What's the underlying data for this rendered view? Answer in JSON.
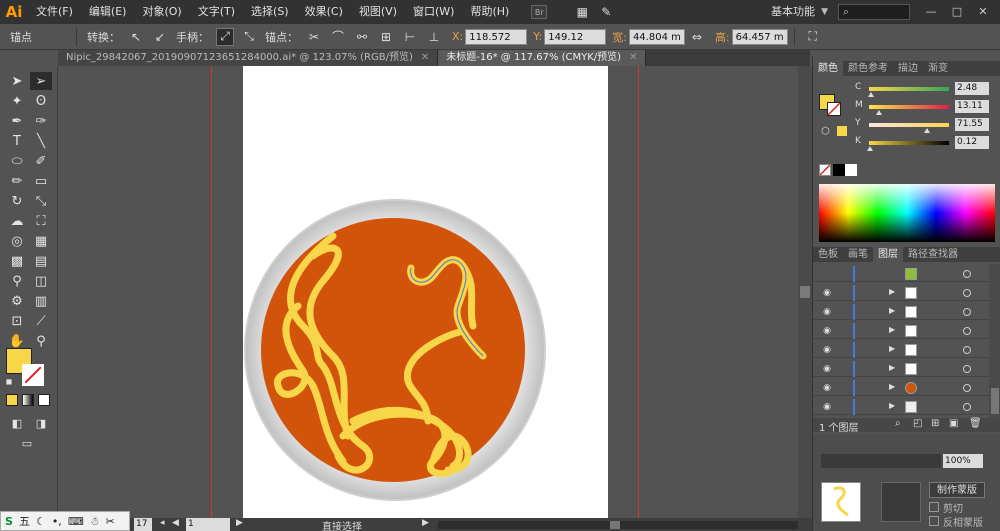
{
  "app": {
    "logo": "Ai",
    "menus": [
      "文件(F)",
      "编辑(E)",
      "对象(O)",
      "文字(T)",
      "选择(S)",
      "效果(C)",
      "视图(V)",
      "窗口(W)",
      "帮助(H)"
    ],
    "br_label": "Br",
    "workspace": "基本功能",
    "window_buttons": [
      "—",
      "□",
      "✕"
    ]
  },
  "control": {
    "anchor": "锚点",
    "convert": "转换：",
    "handle": "手柄：",
    "anchor_points": "锚点：",
    "x_label": "X:",
    "x_value": "118.572 m",
    "y_label": "Y:",
    "y_value": "149.12 mm",
    "w_label": "宽:",
    "w_value": "44.804 m",
    "h_label": "高:",
    "h_value": "64.457 m"
  },
  "tabs": [
    {
      "label": "Nipic_29842067_20190907123651284000.ai* @ 123.07% (RGB/预览)",
      "active": false
    },
    {
      "label": "未标题-16* @ 117.67% (CMYK/预览)",
      "active": true
    }
  ],
  "color_panel": {
    "tabs": [
      "颜色",
      "颜色参考",
      "描边",
      "渐变"
    ],
    "channels": [
      {
        "label": "C",
        "value": "2.48",
        "pos": 0.02
      },
      {
        "label": "M",
        "value": "13.11",
        "pos": 0.13
      },
      {
        "label": "Y",
        "value": "71.55",
        "pos": 0.72
      },
      {
        "label": "K",
        "value": "0.12",
        "pos": 0.01
      }
    ],
    "fill_color": "#f7d64a"
  },
  "layers_panel": {
    "tabs": [
      "色板",
      "画笔",
      "图层",
      "路径查找器"
    ],
    "layer_count": "1 个图层",
    "rows": [
      {
        "expand": false,
        "thumb": "#8fbf3a"
      },
      {
        "expand": true,
        "thumb": "#ffffff"
      },
      {
        "expand": true,
        "thumb": "#ffffff"
      },
      {
        "expand": true,
        "thumb": "#ffffff"
      },
      {
        "expand": true,
        "thumb": "#ffffff"
      },
      {
        "expand": true,
        "thumb": "#ffffff"
      },
      {
        "expand": true,
        "thumb": "#d0550c"
      },
      {
        "expand": true,
        "thumb": "#eeeeee"
      }
    ]
  },
  "transparency": {
    "opacity": "100%",
    "make_mask": "制作蒙版",
    "clip": "剪切",
    "invert_mask": "反相蒙版"
  },
  "status": {
    "zoom": "17",
    "artboard": "1",
    "tool_name": "直接选择"
  },
  "ime": {
    "label": "五"
  },
  "artwork": {
    "plate_color": "#d9d9d9",
    "soup_color": "#d2540b",
    "noodle_color": "#f7d64a"
  }
}
